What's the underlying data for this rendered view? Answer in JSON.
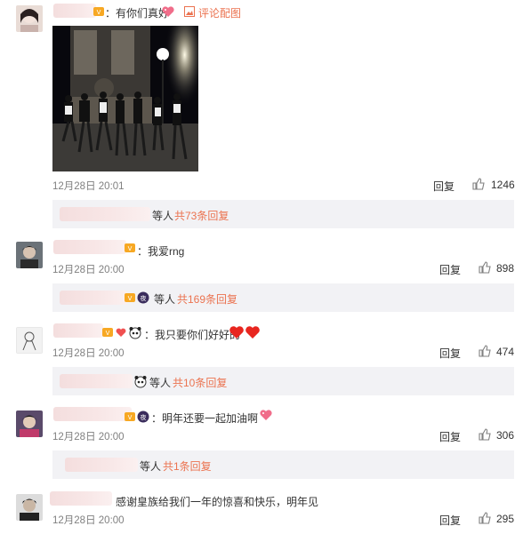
{
  "colors": {
    "accent": "#eb7350",
    "muted": "#808080",
    "subbg": "#f2f2f5"
  },
  "comments": [
    {
      "text": "：有你们真好",
      "emoji": "heart-sparkle-icon",
      "action": "评论配图",
      "time": "12月28日 20:01",
      "reply": "回复",
      "likes": "1246",
      "sub_pre": "等人",
      "sub_link": "共73条回复"
    },
    {
      "text": "：我爱rng",
      "time": "12月28日 20:00",
      "reply": "回复",
      "likes": "898",
      "sub_pre": "等人",
      "sub_link": "共169条回复"
    },
    {
      "text": "：我只要你们好好的",
      "emoji": "two-hearts-icon",
      "time": "12月28日 20:00",
      "reply": "回复",
      "likes": "474",
      "sub_pre": "等人",
      "sub_link": "共10条回复"
    },
    {
      "text": "：明年还要一起加油啊",
      "emoji": "heart-sparkle-icon",
      "time": "12月28日 20:00",
      "reply": "回复",
      "likes": "306",
      "sub_pre": "等人",
      "sub_link": "共1条回复"
    },
    {
      "text": "感谢皇族给我们一年的惊喜和快乐，明年见",
      "time": "12月28日 20:00",
      "reply": "回复",
      "likes": "295"
    }
  ]
}
